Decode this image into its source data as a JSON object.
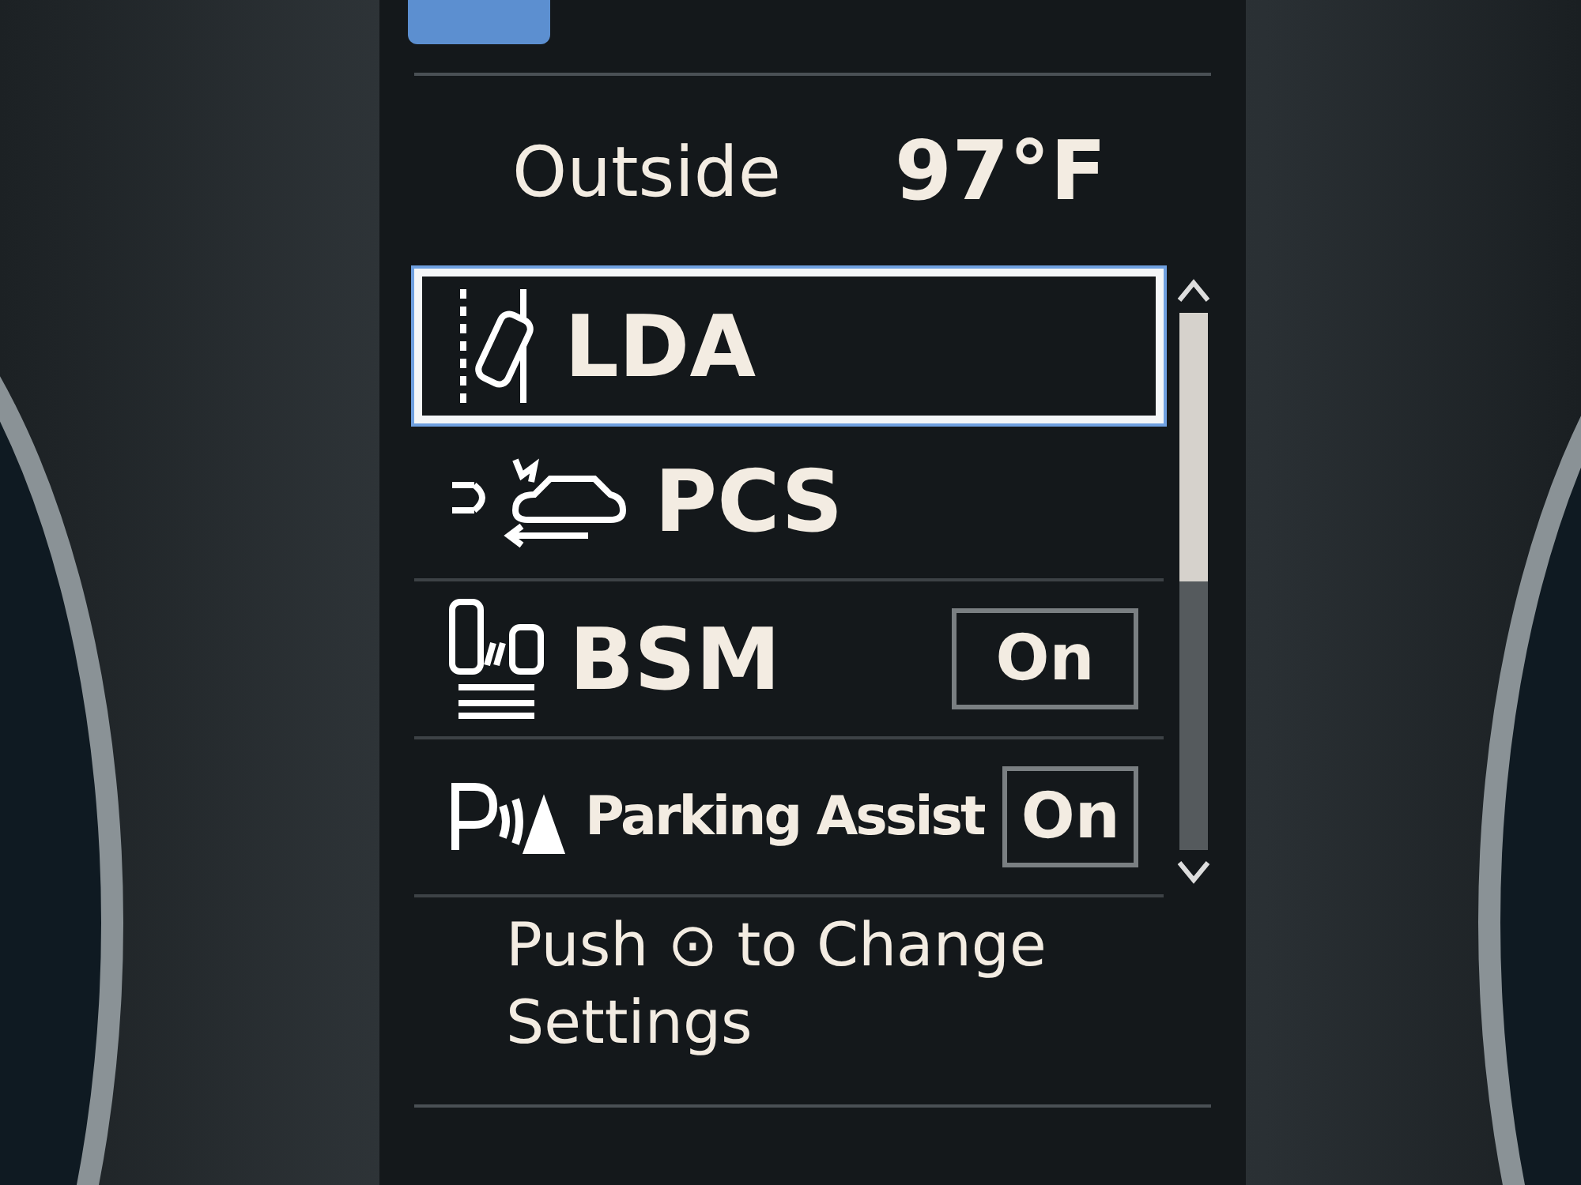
{
  "outside": {
    "label": "Outside",
    "temperature": "97°F"
  },
  "settings": [
    {
      "label": "LDA",
      "selected": true
    },
    {
      "label": "PCS",
      "selected": false
    },
    {
      "label": "BSM",
      "selected": false,
      "value": "On"
    },
    {
      "label": "Parking Assist",
      "selected": false,
      "value": "On"
    }
  ],
  "hint": "Push ⊙ to Change Settings"
}
